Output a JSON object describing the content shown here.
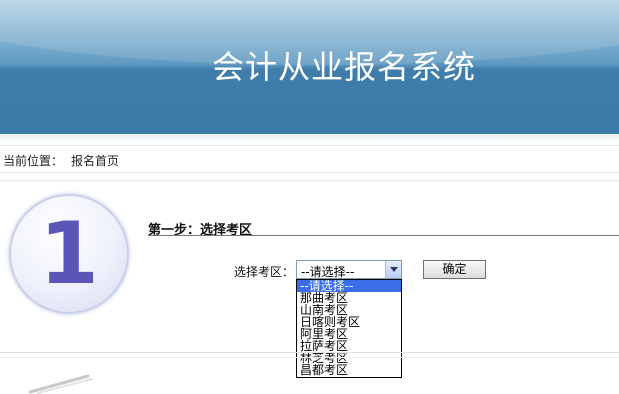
{
  "header": {
    "title": "会计从业报名系统"
  },
  "breadcrumb": {
    "label": "当前位置：",
    "current": "报名首页"
  },
  "step": {
    "number": "1",
    "title": "第一步：选择考区"
  },
  "form": {
    "field_label": "选择考区：",
    "select_value": "--请选择--",
    "submit_label": "确定",
    "options": [
      {
        "label": "--请选择--",
        "selected": true
      },
      {
        "label": "那曲考区",
        "selected": false
      },
      {
        "label": "山南考区",
        "selected": false
      },
      {
        "label": "日喀则考区",
        "selected": false
      },
      {
        "label": "阿里考区",
        "selected": false
      },
      {
        "label": "拉萨考区",
        "selected": false
      },
      {
        "label": "林芝考区",
        "selected": false
      },
      {
        "label": "昌都考区",
        "selected": false
      }
    ]
  },
  "colors": {
    "banner": "#3f7eab",
    "selection": "#3a6ee8",
    "step_number": "#5a56b8"
  }
}
